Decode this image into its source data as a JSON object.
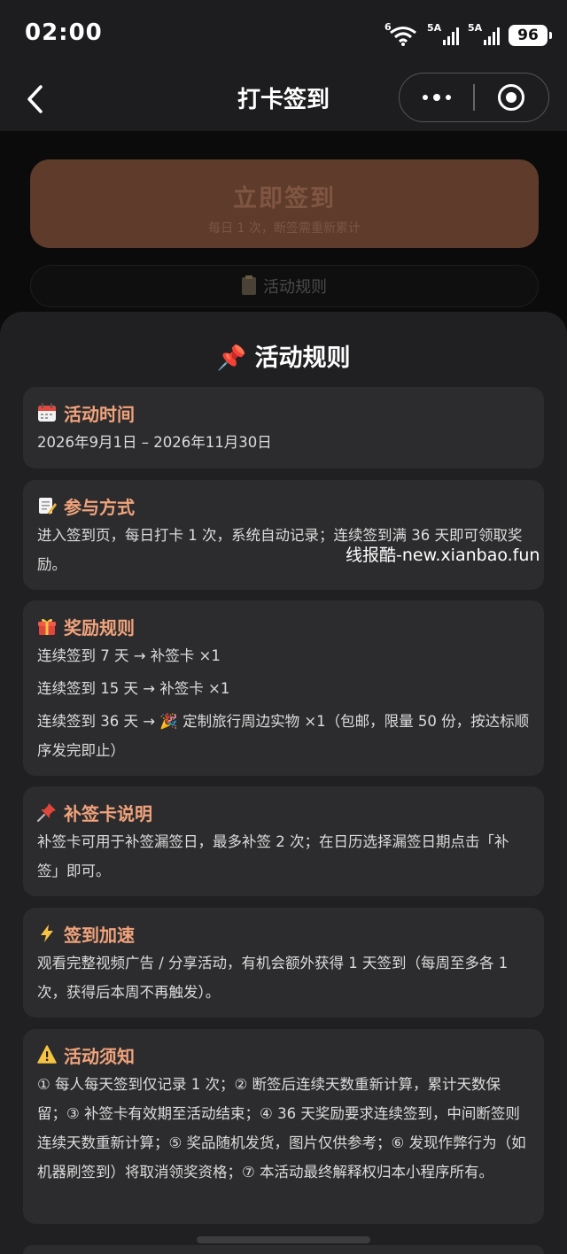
{
  "status_bar": {
    "time": "02:00",
    "wifi_label": "6",
    "sim1_label": "5A",
    "sim2_label": "5A",
    "battery": "96"
  },
  "nav": {
    "title": "打卡签到",
    "back_icon": "chevron-left-icon",
    "more_icon": "more-dots-icon",
    "close_icon": "target-icon"
  },
  "background_page": {
    "checkin_button": "立即签到",
    "checkin_hint": "每日 1 次，断签需重新累计",
    "rules_button": "活动规则"
  },
  "sheet": {
    "title": "📌 活动规则",
    "cards": [
      {
        "icon": "calendar-icon",
        "title": "活动时间",
        "lines": [
          "2026年9月1日 – 2026年11月30日"
        ]
      },
      {
        "icon": "memo-icon",
        "title": "参与方式",
        "lines": [
          "进入签到页，每日打卡 1 次，系统自动记录；连续签到满 36 天即可领取奖励。"
        ]
      },
      {
        "icon": "gift-icon",
        "title": "奖励规则",
        "lines": [
          "连续签到 7 天 → 补签卡 ×1",
          "连续签到 15 天 → 补签卡 ×1",
          "连续签到 36 天 → 🎉 定制旅行周边实物 ×1（包邮，限量 50 份，按达标顺序发完即止）"
        ]
      },
      {
        "icon": "pushpin-icon",
        "title": "补签卡说明",
        "lines": [
          "补签卡可用于补签漏签日，最多补签 2 次；在日历选择漏签日期点击「补签」即可。"
        ]
      },
      {
        "icon": "lightning-icon",
        "title": "签到加速",
        "lines": [
          "观看完整视频广告 / 分享活动，有机会额外获得 1 天签到（每周至多各 1 次，获得后本周不再触发）。"
        ]
      },
      {
        "icon": "warning-icon",
        "title": "活动须知",
        "lines": [
          "① 每人每天签到仅记录 1 次；② 断签后连续天数重新计算，累计天数保留；③ 补签卡有效期至活动结束；④ 36 天奖励要求连续签到，中间断签则连续天数重新计算；⑤ 奖品随机发货，图片仅供参考；⑥ 发现作弊行为（如机器刷签到）将取消领奖资格；⑦ 本活动最终解释权归本小程序所有。"
        ]
      }
    ]
  },
  "watermark": "线报酷-new.xianbao.fun",
  "colors": {
    "accent_title": "#f0a37c",
    "sheet_bg": "#202022",
    "card_bg": "#2c2c2e",
    "checkin_button_bg": "#5e3b2b"
  }
}
